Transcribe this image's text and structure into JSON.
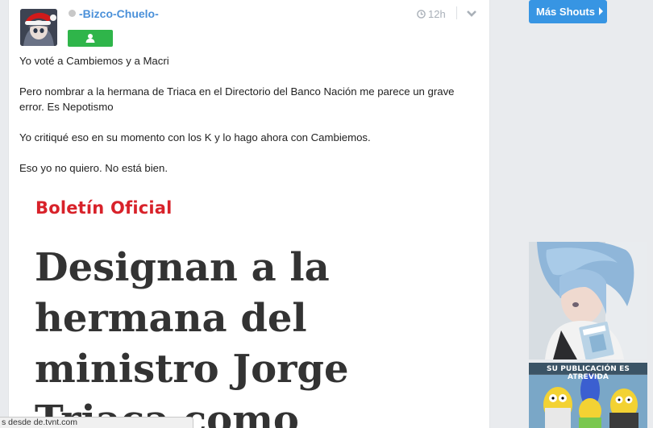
{
  "post": {
    "username": "-Bizco-Chuelo-",
    "time": "12h",
    "paragraphs": [
      "Yo voté a Cambiemos y a Macri",
      "Pero nombrar a la hermana de Triaca en el Directorio del Banco Nación me parece un grave error. Es Nepotismo",
      "Yo critiqué eso en su momento con los K y lo hago ahora con Cambiemos.",
      "Eso yo no quiero. No está bien."
    ],
    "embed": {
      "kicker": "Boletín Oficial",
      "headline": "Designan a la hermana del ministro Jorge Triaca como"
    }
  },
  "sidebar": {
    "more_shouts_label": "Más Shouts",
    "meme_caption": "SU PUBLICACIÓN ES ATREVIDA"
  },
  "statusbar": {
    "text": "s desde de.tvnt.com"
  },
  "colors": {
    "username": "#4a90d9",
    "rank_badge": "#2fb54a",
    "button": "#3795e3",
    "kicker": "#d8222a"
  },
  "icons": {
    "time": "clock-icon",
    "menu": "chevron-down-icon",
    "rank": "user-rank-icon",
    "button": "caret-right-icon"
  }
}
